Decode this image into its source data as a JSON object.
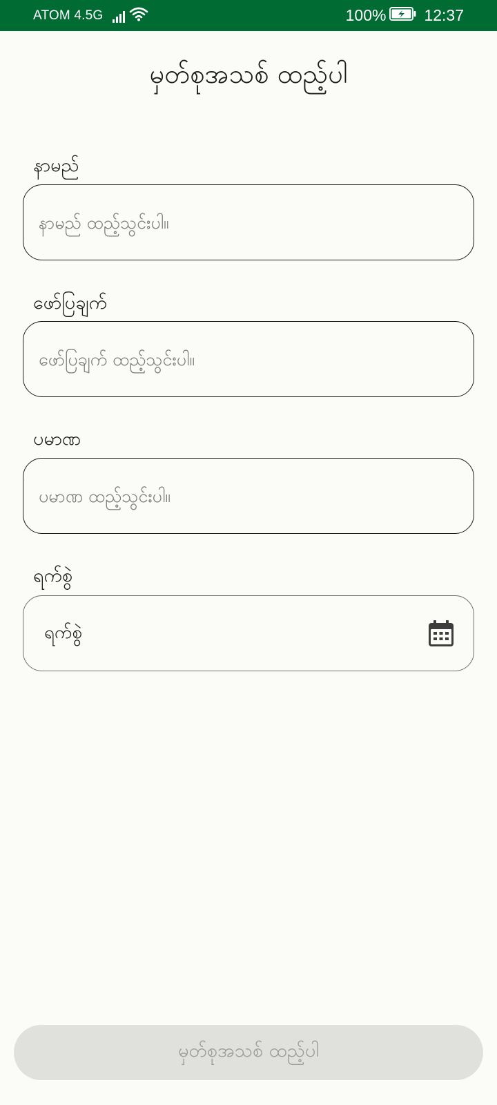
{
  "status_bar": {
    "carrier": "ATOM 4.5G",
    "battery_percent": "100%",
    "time": "12:37",
    "icons": [
      "signal-icon",
      "wifi-icon",
      "battery-charging-icon"
    ]
  },
  "page": {
    "title": "မှတ်စုအသစ် ထည့်ပါ"
  },
  "form": {
    "name": {
      "label": "နာမည်",
      "placeholder": "နာမည် ထည့်သွင်းပါ။",
      "value": ""
    },
    "description": {
      "label": "ဖော်ပြချက်",
      "placeholder": "ဖော်ပြချက် ထည့်သွင်းပါ။",
      "value": ""
    },
    "amount": {
      "label": "ပမာဏ",
      "placeholder": "ပမာဏ ထည့်သွင်းပါ။",
      "value": ""
    },
    "date": {
      "label": "ရက်စွဲ",
      "value": "ရက်စွဲ",
      "icon": "calendar-icon"
    }
  },
  "actions": {
    "submit_label": "မှတ်စုအသစ် ထည့်ပါ"
  },
  "colors": {
    "status_bar": "#006b33",
    "background": "#fbfcf8",
    "button_disabled_bg": "#e0e1dd",
    "button_disabled_text": "#9a9a98"
  }
}
